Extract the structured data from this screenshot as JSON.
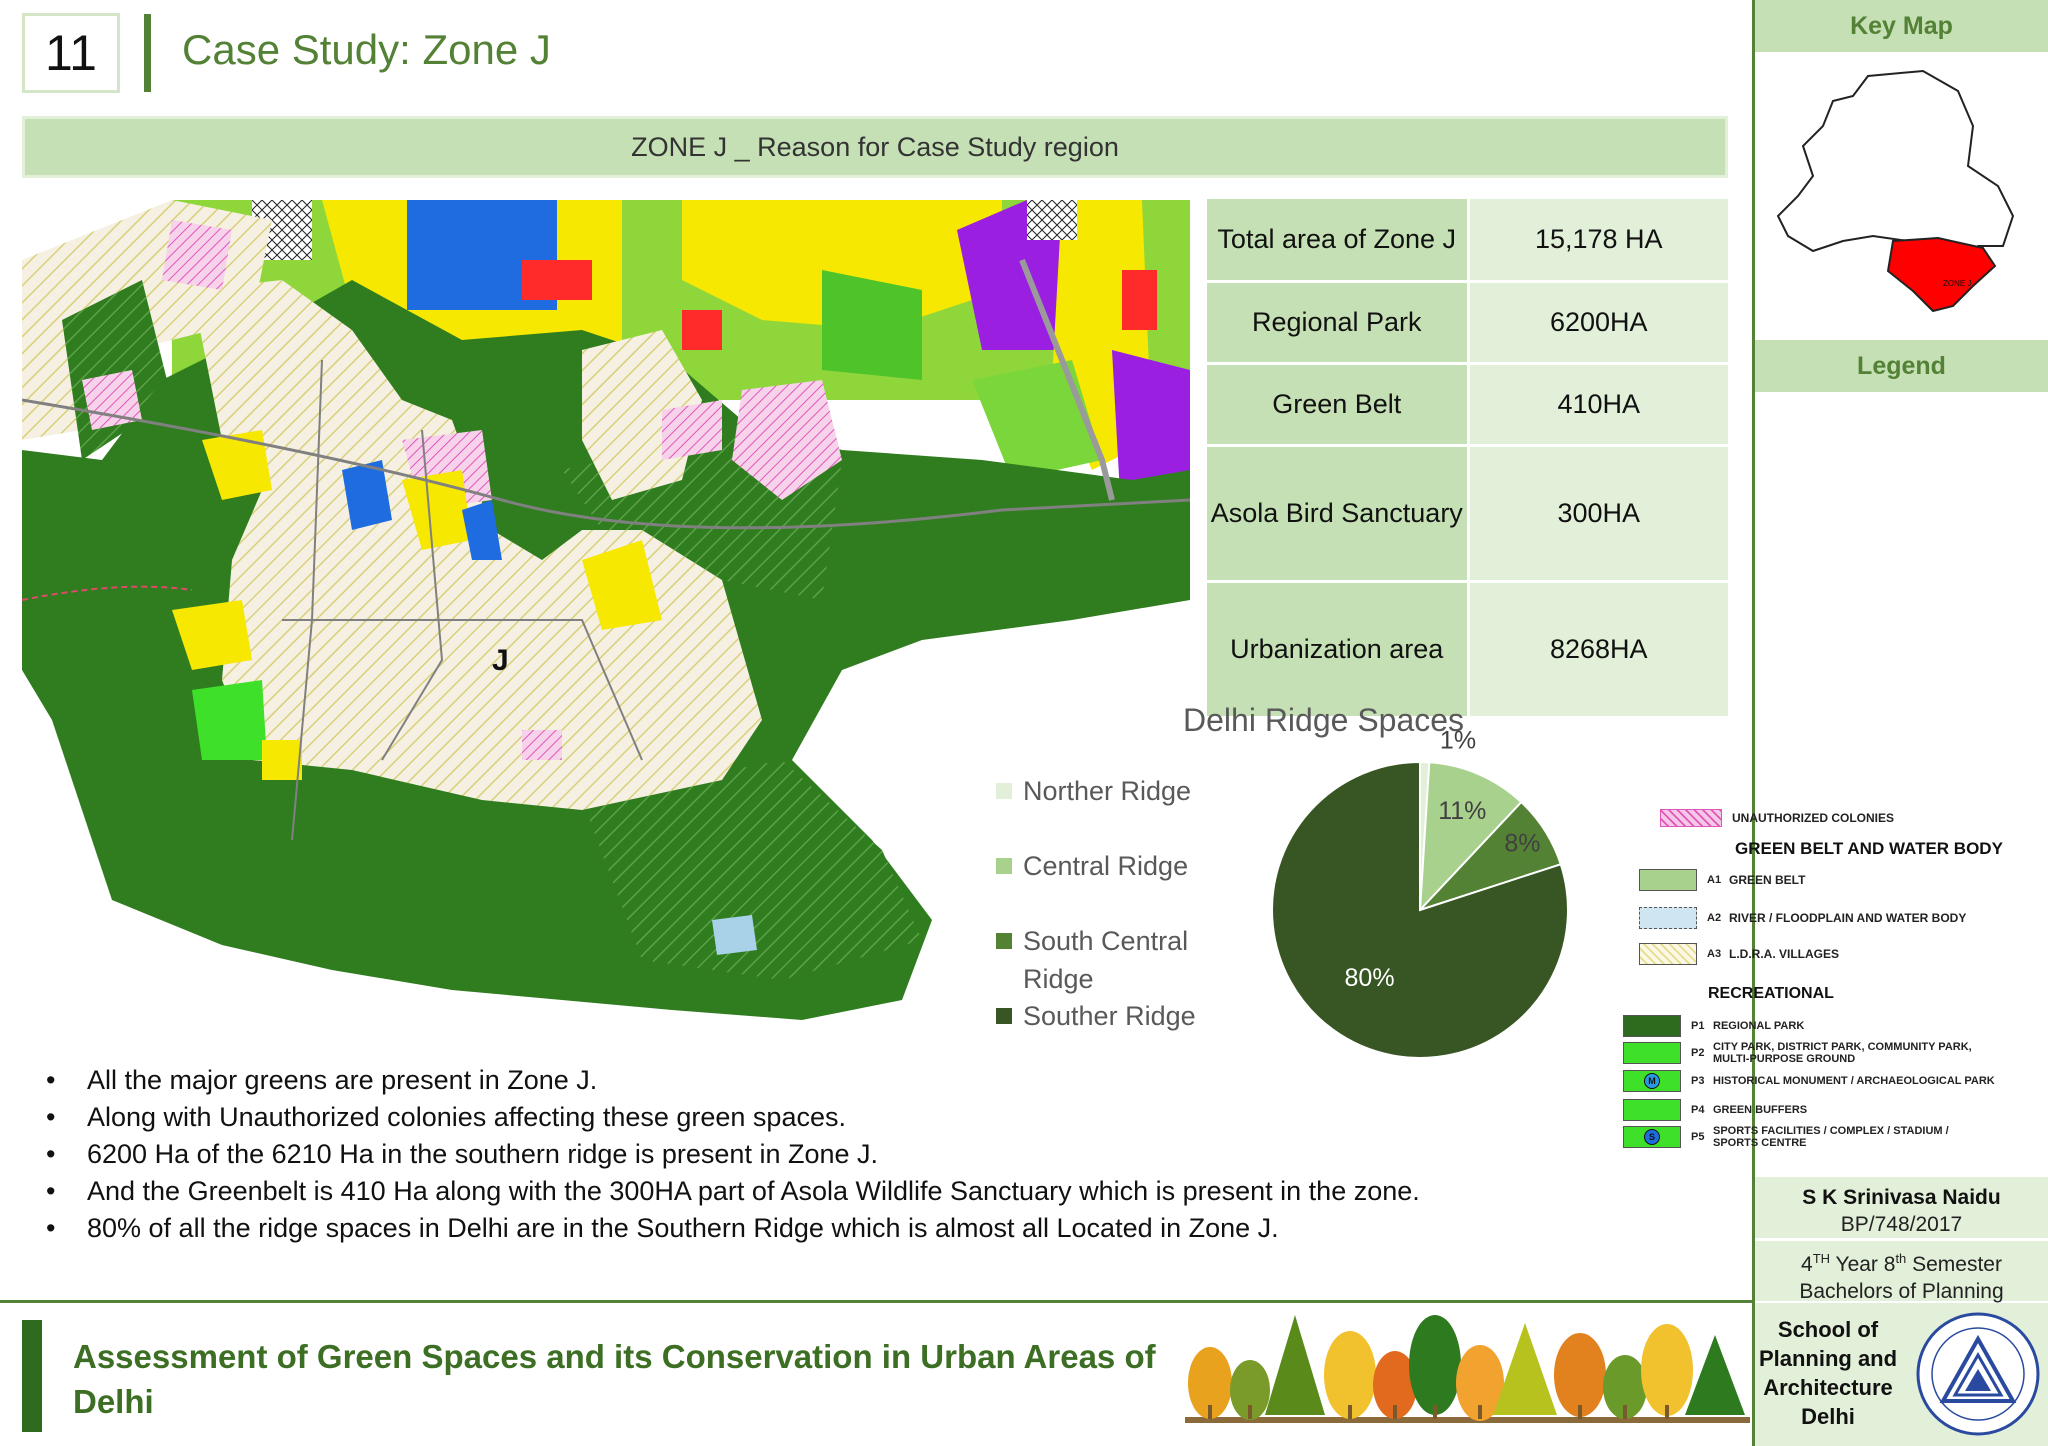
{
  "slide": {
    "number": "11",
    "title": "Case Study: Zone J",
    "banner": "ZONE J _ Reason for Case Study region"
  },
  "map": {
    "zone_label": "J"
  },
  "stats": [
    {
      "label": "Total area of Zone J",
      "value": "15,178 HA"
    },
    {
      "label": "Regional Park",
      "value": "6200HA"
    },
    {
      "label": "Green Belt",
      "value": "410HA"
    },
    {
      "label": "Asola Bird Sanctuary",
      "value": "300HA"
    },
    {
      "label": "Urbanization area",
      "value": "8268HA"
    }
  ],
  "chart_data": {
    "type": "pie",
    "title": "Delhi Ridge Spaces",
    "categories": [
      "Norther Ridge",
      "Central Ridge",
      "South Central Ridge",
      "Souther Ridge"
    ],
    "values": [
      1,
      11,
      8,
      80
    ],
    "labels": [
      "1%",
      "11%",
      "8%",
      "80%"
    ],
    "colors": [
      "#e2efd9",
      "#a9d18e",
      "#548235",
      "#375623"
    ],
    "legend": "left"
  },
  "legend_text": {
    "legend_line1": "South Central",
    "legend_line2": "Ridge"
  },
  "bullets": [
    "All the major greens are present in Zone J.",
    "Along with Unauthorized colonies affecting these green spaces.",
    "6200 Ha of the 6210 Ha in the southern ridge is present in Zone J.",
    "And the Greenbelt is 410 Ha along with the 300HA part of Asola Wildlife Sanctuary which is present in the zone.",
    "80% of all the ridge spaces in Delhi are in the Southern Ridge which is almost all Located in Zone J."
  ],
  "footer": {
    "title": "Assessment of Green Spaces and its Conservation in Urban Areas of Delhi"
  },
  "sidebar": {
    "key_map_title": "Key Map",
    "key_map_zone_label": "ZONE J",
    "legend_title": "Legend"
  },
  "map_legend": {
    "unauthorized": "UNAUTHORIZED COLONIES",
    "green_belt_heading": "GREEN BELT AND WATER BODY",
    "a1_code": "A1",
    "a1": "GREEN BELT",
    "a2_code": "A2",
    "a2": "RIVER / FLOODPLAIN AND WATER BODY",
    "a3_code": "A3",
    "a3": "L.D.R.A. VILLAGES",
    "recreational_heading": "RECREATIONAL",
    "p1_code": "P1",
    "p1": "REGIONAL PARK",
    "p2_code": "P2",
    "p2a": "CITY PARK, DISTRICT PARK, COMMUNITY PARK,",
    "p2b": "MULTI-PURPOSE GROUND",
    "p3_code": "P3",
    "p3": "HISTORICAL MONUMENT / ARCHAEOLOGICAL PARK",
    "p3_icon": "M",
    "p4_code": "P4",
    "p4": "GREEN BUFFERS",
    "p5_code": "P5",
    "p5a": "SPORTS FACILITIES / COMPLEX / STADIUM /",
    "p5b": "SPORTS CENTRE",
    "p5_icon": "S"
  },
  "author": {
    "name": "S K Srinivasa Naidu",
    "roll": "BP/748/2017",
    "year_num": "4",
    "year_sup": "TH",
    "year_mid": " Year 8",
    "sem_sup": "th",
    "sem_text": " Semester",
    "degree": "Bachelors of Planning"
  },
  "school": {
    "line1": "School of",
    "line2": "Planning and",
    "line3": "Architecture",
    "line4": "Delhi"
  }
}
